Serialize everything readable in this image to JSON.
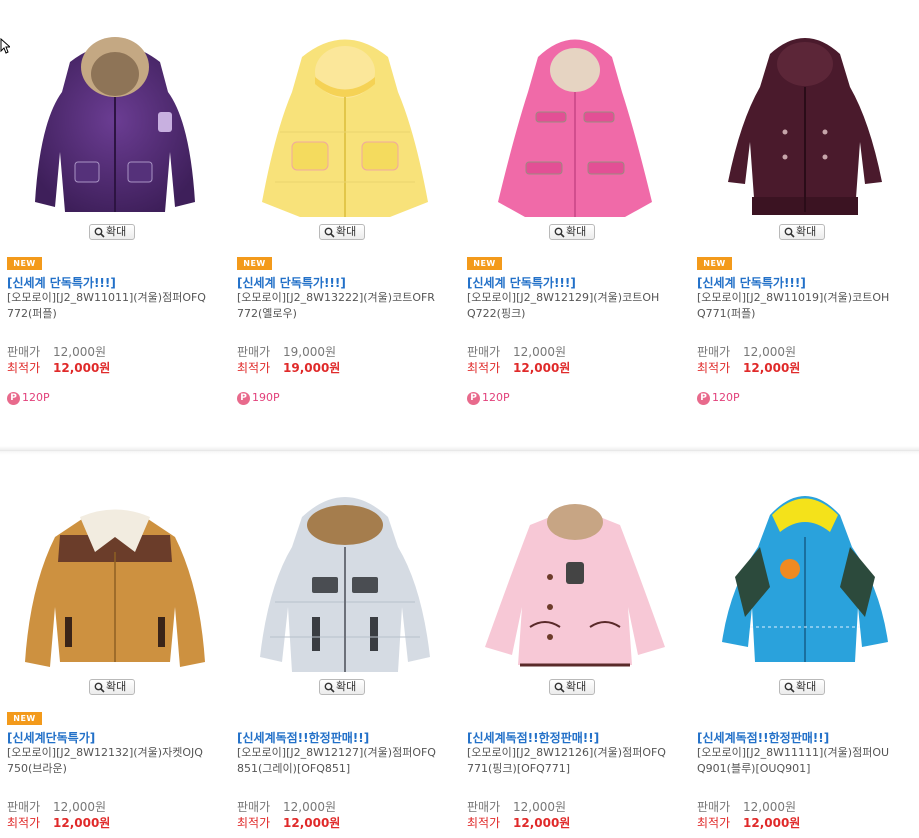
{
  "zoom_label": "확대",
  "sale_label": "판매가",
  "best_label": "최적가",
  "new_label": "NEW",
  "point_icon": "P",
  "colors": {
    "promo": "#2270c8",
    "best_price": "#e02a2a",
    "badge": "#f39a1b",
    "points": "#e2407a"
  },
  "products": [
    {
      "image_icon": "purple-jacket",
      "new": true,
      "promo": "[신세계 단독특가!!!]",
      "name": "[오모로이][J2_8W11011](겨울)점퍼OFQ772(퍼플)",
      "sale_price": "12,000원",
      "best_price": "12,000원",
      "points": "120P"
    },
    {
      "image_icon": "yellow-coat",
      "new": true,
      "promo": "[신세계 단독특가!!!]",
      "name": "[오모로이][J2_8W13222](겨울)코트OFR772(옐로우)",
      "sale_price": "19,000원",
      "best_price": "19,000원",
      "points": "190P"
    },
    {
      "image_icon": "pink-coat",
      "new": true,
      "promo": "[신세계 단독특가!!!]",
      "name": "[오모로이][J2_8W12129](겨울)코트OHQ722(핑크)",
      "sale_price": "12,000원",
      "best_price": "12,000원",
      "points": "120P"
    },
    {
      "image_icon": "plum-coat",
      "new": true,
      "promo": "[신세계 단독특가!!!]",
      "name": "[오모로이][J2_8W11019](겨울)코트OHQ771(퍼플)",
      "sale_price": "12,000원",
      "best_price": "12,000원",
      "points": "120P"
    },
    {
      "image_icon": "brown-corduroy-jacket",
      "new": true,
      "promo": "[신세계단독특가]",
      "name": "[오모로이][J2_8W12132](겨울)자켓OJQ750(브라운)",
      "sale_price": "12,000원",
      "best_price": "12,000원"
    },
    {
      "image_icon": "grey-padded-jumper",
      "new": false,
      "promo": "[신세계독점!!한정판매!!]",
      "name": "[오모로이][J2_8W12127](겨울)점퍼OFQ851(그레이)[OFQ851]",
      "sale_price": "12,000원",
      "best_price": "12,000원"
    },
    {
      "image_icon": "light-pink-quilted-coat",
      "new": false,
      "promo": "[신세계독점!!한정판매!!]",
      "name": "[오모로이][J2_8W12126](겨울)점퍼OFQ771(핑크)[OFQ771]",
      "sale_price": "12,000원",
      "best_price": "12,000원"
    },
    {
      "image_icon": "blue-hooded-jumper",
      "new": false,
      "promo": "[신세계독점!!한정판매!!]",
      "name": "[오모로이][J2_8W11111](겨울)점퍼OUQ901(블루)[OUQ901]",
      "sale_price": "12,000원",
      "best_price": "12,000원"
    }
  ]
}
